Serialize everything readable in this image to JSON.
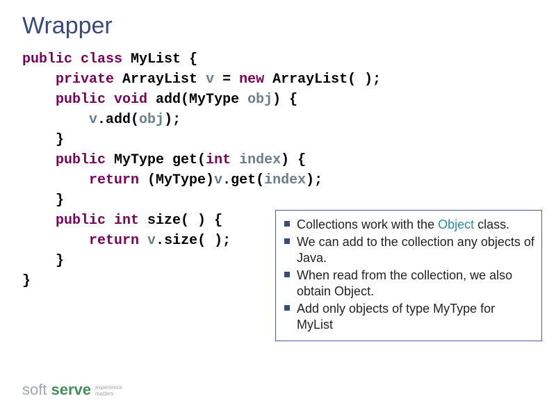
{
  "title": "Wrapper",
  "code": {
    "l1": {
      "kw1": "public class",
      "name": "MyList",
      "end": " {"
    },
    "l2": {
      "kw": "private",
      "type": " ArrayList ",
      "var": "v",
      "eq": " = ",
      "kw2": "new",
      "type2": " ArrayList( );"
    },
    "l3": {
      "kw": "public void",
      "method": " add(MyType ",
      "param": "obj",
      "end": ") {"
    },
    "l4": {
      "var": "v",
      "call": ".add(",
      "arg": "obj",
      "end": ");"
    },
    "l5": {
      "brace": "}"
    },
    "l6": {
      "kw": "public",
      "rtype": " MyType get(",
      "kw2": "int",
      "sp": " ",
      "param": "index",
      "end": ") {"
    },
    "l7": {
      "kw": "return",
      "cast": " (MyType)",
      "var": "v",
      "call": ".get(",
      "arg": "index",
      "end": ");"
    },
    "l8": {
      "brace": "}"
    },
    "l9": {
      "kw": "public int",
      "method": " size( ) {"
    },
    "l10": {
      "kw": "return",
      "sp": " ",
      "var": "v",
      "call": ".size( );"
    },
    "l11": {
      "brace": "}"
    },
    "l12": {
      "brace": "}"
    }
  },
  "callout": {
    "items": [
      {
        "prefix": "Collections work with the ",
        "highlight": "Object",
        "suffix": " class."
      },
      {
        "text": "We can add to the collection any objects of Java."
      },
      {
        "text": "When read from the collection, we also obtain Object."
      },
      {
        "text": "Add only objects of type MyType for MyList"
      }
    ]
  },
  "logo": {
    "soft": "soft",
    "serve": "serve",
    "tag1": "experience",
    "tag2": "matters"
  }
}
